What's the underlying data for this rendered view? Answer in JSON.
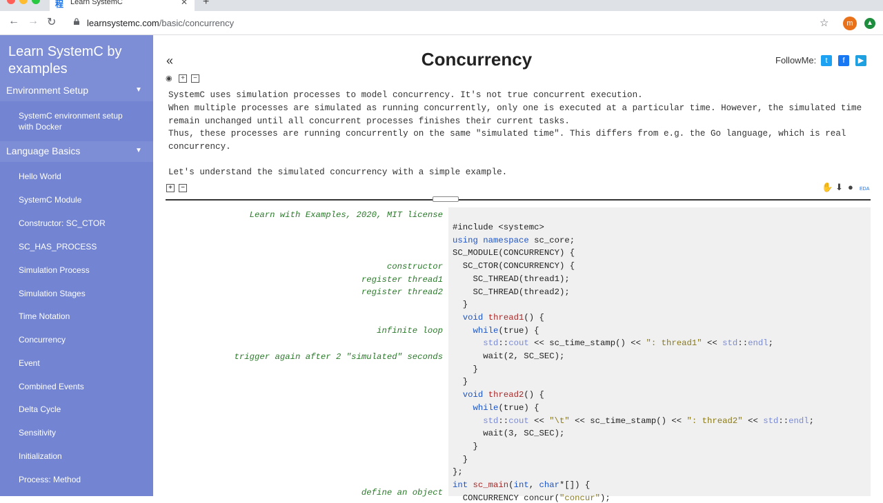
{
  "browser": {
    "tab_title": "Learn SystemC",
    "url_host": "learnsystemc.com",
    "url_path": "/basic/concurrency",
    "profile_initial": "m"
  },
  "sidebar": {
    "title": "Learn SystemC by examples",
    "sections": [
      {
        "label": "Environment Setup",
        "items": [
          "SystemC environment setup with Docker"
        ]
      },
      {
        "label": "Language Basics",
        "items": [
          "Hello World",
          "SystemC Module",
          "Constructor: SC_CTOR",
          "SC_HAS_PROCESS",
          "Simulation Process",
          "Simulation Stages",
          "Time Notation",
          "Concurrency",
          "Event",
          "Combined Events",
          "Delta Cycle",
          "Sensitivity",
          "Initialization",
          "Process: Method"
        ]
      }
    ]
  },
  "main": {
    "back": "«",
    "title": "Concurrency",
    "follow_label": "FollowMe:",
    "paragraphs": [
      "SystemC uses simulation processes to model concurrency. It's not true concurrent execution.",
      "When multiple processes are simulated as running concurrently, only one is executed at a particular time. However, the simulated time",
      "remain unchanged until all concurrent processes finishes their current tasks.",
      "Thus, these processes are running concurrently on the same \"simulated time\". This differs from e.g. the Go language, which is real",
      "concurrency.",
      "",
      "Let's understand the simulated concurrency with a simple example."
    ],
    "tool_eda": "EDA"
  },
  "code_comments": [
    "Learn with Examples, 2020, MIT license",
    "constructor",
    "register thread1",
    "register thread2",
    "infinite loop",
    "trigger again after 2 \"simulated\" seconds",
    "define an object"
  ],
  "code_lines": [
    "#include <systemc>",
    "using namespace sc_core;",
    "SC_MODULE(CONCURRENCY) {",
    "  SC_CTOR(CONCURRENCY) {",
    "    SC_THREAD(thread1);",
    "    SC_THREAD(thread2);",
    "  }",
    "  void thread1() {",
    "    while(true) {",
    "      std::cout << sc_time_stamp() << \": thread1\" << std::endl;",
    "      wait(2, SC_SEC);",
    "    }",
    "  }",
    "  void thread2() {",
    "    while(true) {",
    "      std::cout << \"\\t\" << sc_time_stamp() << \": thread2\" << std::endl;",
    "      wait(3, SC_SEC);",
    "    }",
    "  }",
    "};",
    "int sc_main(int, char*[]) {",
    "  CONCURRENCY concur(\"concur\");"
  ]
}
